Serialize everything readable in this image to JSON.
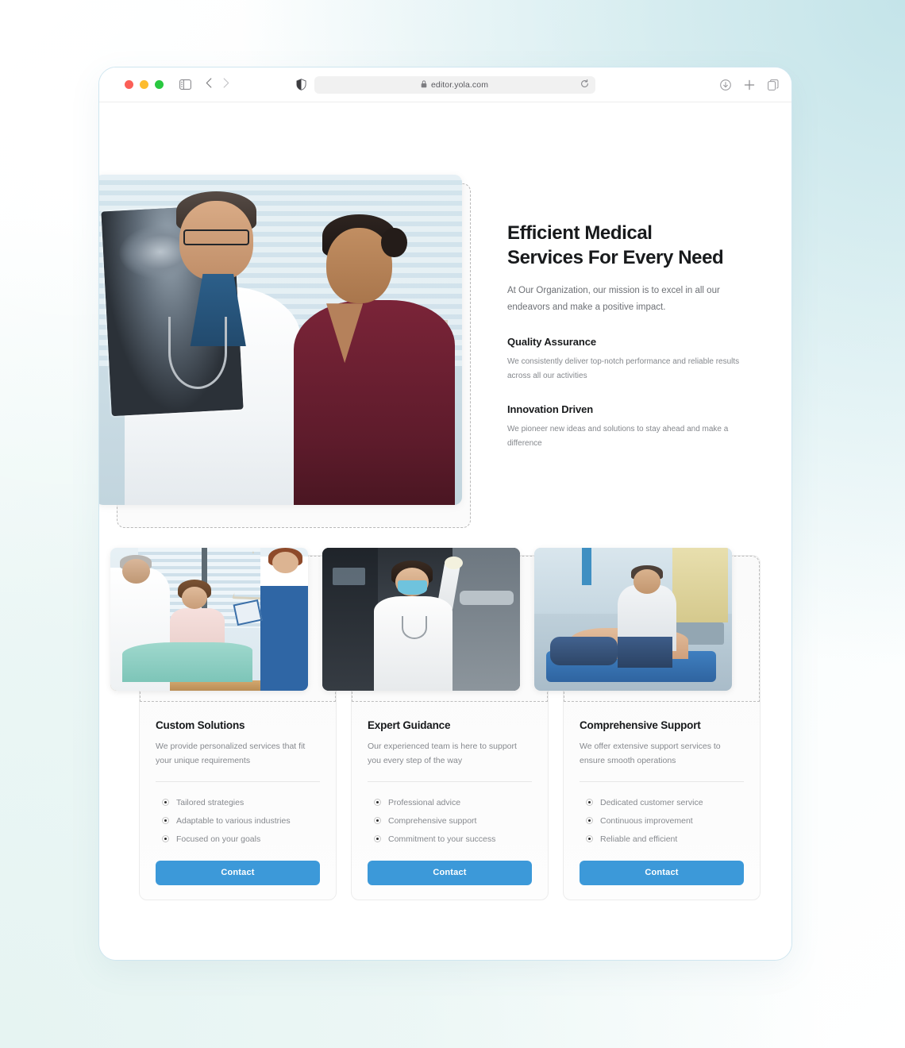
{
  "browser": {
    "url": "editor.yola.com",
    "lock_icon": "lock-icon",
    "reload_icon": "reload-icon",
    "sidebar_icon": "sidebar-toggle-icon",
    "back_icon": "chevron-left-icon",
    "forward_icon": "chevron-right-icon",
    "shield_icon": "privacy-shield-icon",
    "download_icon": "download-icon",
    "new_tab_icon": "plus-icon",
    "tab_overview_icon": "tab-overview-icon",
    "traffic_lights": [
      "close-red",
      "minimize-yellow",
      "maximize-green"
    ]
  },
  "hero": {
    "title_line1": "Efficient Medical",
    "title_line2": "Services For Every Need",
    "subtitle": "At Our Organization, our mission is to excel in all our endeavors and make a positive impact.",
    "image_alt": "doctor-and-patient-reviewing-xray",
    "features": [
      {
        "title": "Quality Assurance",
        "body": "We consistently deliver top-notch performance and reliable results across all our activities"
      },
      {
        "title": "Innovation Driven",
        "body": "We pioneer new ideas and solutions to stay ahead and make a difference"
      }
    ]
  },
  "cards": [
    {
      "image_alt": "doctor-examining-hospital-patient",
      "title": "Custom Solutions",
      "description": "We provide personalized services that fit your unique requirements",
      "items": [
        "Tailored strategies",
        "Adaptable to various industries",
        "Focused on your goals"
      ],
      "button_label": "Contact"
    },
    {
      "image_alt": "masked-lab-technician-with-equipment",
      "title": "Expert Guidance",
      "description": "Our experienced team is here to support you every step of the way",
      "items": [
        "Professional advice",
        "Comprehensive support",
        "Commitment to your success"
      ],
      "button_label": "Contact"
    },
    {
      "image_alt": "therapist-treating-patient-on-table",
      "title": "Comprehensive Support",
      "description": "We offer extensive support services to ensure smooth operations",
      "items": [
        "Dedicated customer service",
        "Continuous improvement",
        "Reliable and efficient"
      ],
      "button_label": "Contact"
    }
  ],
  "colors": {
    "accent_blue": "#3c99d9",
    "heading": "#181a1c",
    "body_text": "#86898e",
    "card_border": "#ececec",
    "selection_dash": "#bdbdbd",
    "window_border": "#cfe6f0"
  }
}
